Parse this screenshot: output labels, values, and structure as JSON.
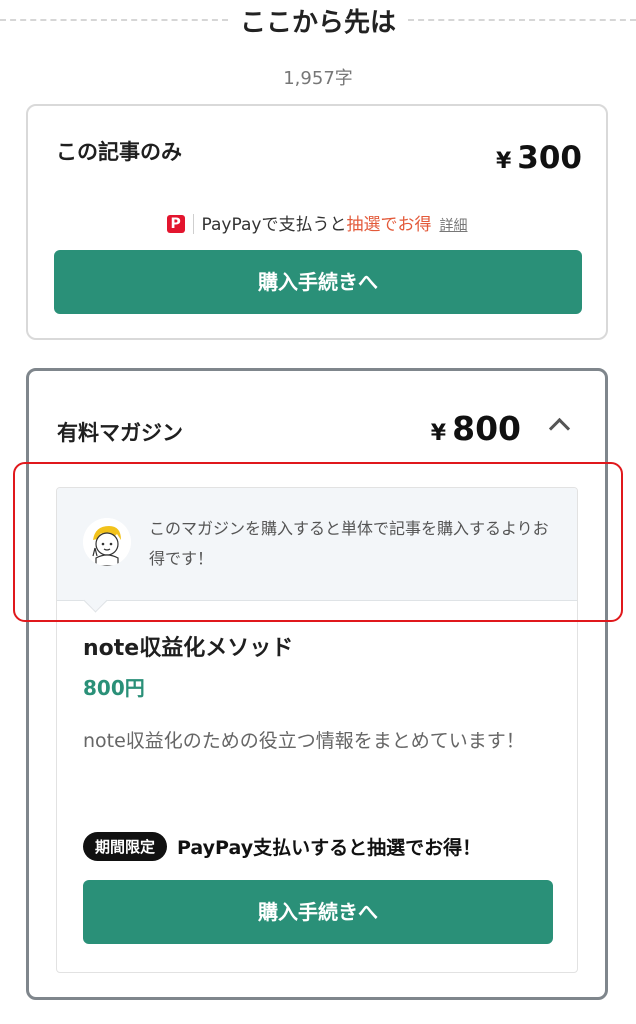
{
  "section_divider": {
    "text": "ここから先は"
  },
  "char_count": "1,957字",
  "article_card": {
    "title": "この記事のみ",
    "price_currency": "¥",
    "price": "300",
    "promo": {
      "icon": "paypay-icon",
      "text_before": "PayPayで支払うと",
      "text_accent": "抽選でお得",
      "detail_link": "詳細",
      "accent_color": "#e35a3a"
    },
    "buy_button": "購入手続きへ"
  },
  "magazine_card": {
    "title": "有料マガジン",
    "price_currency": "¥",
    "price": "800",
    "toggle_icon": "chevron-up-icon",
    "note": {
      "avatar": "character-avatar",
      "text": "このマガジンを購入すると単体で記事を購入するよりお得です！"
    },
    "magazine_name": "note収益化メソッド",
    "magazine_price": "800円",
    "description": "note収益化のための役立つ情報をまとめています！",
    "limited_badge": "期間限定",
    "limited_text": "PayPay支払いすると抽選でお得！",
    "buy_button": "購入手続きへ"
  },
  "colors": {
    "primary_button": "#2a9078",
    "price_green": "#2a9078",
    "highlight_border": "#e0181c",
    "paypay_red": "#e3152e"
  }
}
